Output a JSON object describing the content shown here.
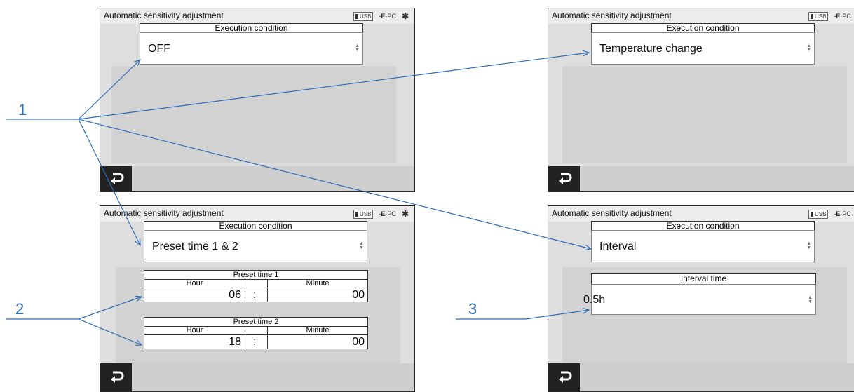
{
  "screens": {
    "common": {
      "title": "Automatic sensitivity adjustment",
      "status_usb": "USB",
      "status_pc": "PC",
      "bluetooth_glyph": "✱",
      "exec_header": "Execution condition"
    },
    "off": {
      "exec_value": "OFF"
    },
    "temperature": {
      "exec_value": "Temperature change"
    },
    "preset": {
      "exec_value": "Preset time 1 & 2",
      "preset1": {
        "header": "Preset time 1",
        "hour_label": "Hour",
        "minute_label": "Minute",
        "hour": "06",
        "sep": ":",
        "minute": "00"
      },
      "preset2": {
        "header": "Preset time 2",
        "hour_label": "Hour",
        "minute_label": "Minute",
        "hour": "18",
        "sep": ":",
        "minute": "00"
      }
    },
    "interval": {
      "exec_value": "Interval",
      "interval_header": "Interval time",
      "interval_value": "0.5h"
    }
  },
  "callouts": {
    "c1": "1",
    "c2": "2",
    "c3": "3"
  },
  "colors": {
    "callout": "#2e6db4",
    "screen_bg": "#dedede",
    "back_button": "#222222"
  }
}
